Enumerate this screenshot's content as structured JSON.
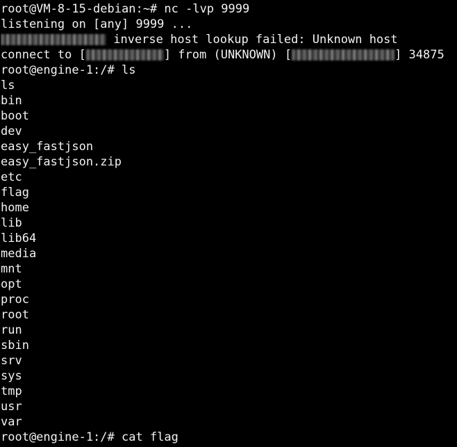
{
  "terminal": {
    "cmd_nc": "root@VM-8-15-debian:~# nc -lvp 9999",
    "listening": "listening on [any] 9999 ...",
    "lookup_failed": " inverse host lookup failed: Unknown host",
    "connect_prefix": "connect to [",
    "connect_mid": "] from (UNKNOWN) [",
    "connect_suffix": "] 34875",
    "cmd_ls": "root@engine-1:/# ls",
    "listing": [
      "ls",
      "bin",
      "boot",
      "dev",
      "easy_fastjson",
      "easy_fastjson.zip",
      "etc",
      "flag",
      "home",
      "lib",
      "lib64",
      "media",
      "mnt",
      "opt",
      "proc",
      "root",
      "run",
      "sbin",
      "srv",
      "sys",
      "tmp",
      "usr",
      "var"
    ],
    "cmd_cat": "root@engine-1:/# cat flag"
  }
}
